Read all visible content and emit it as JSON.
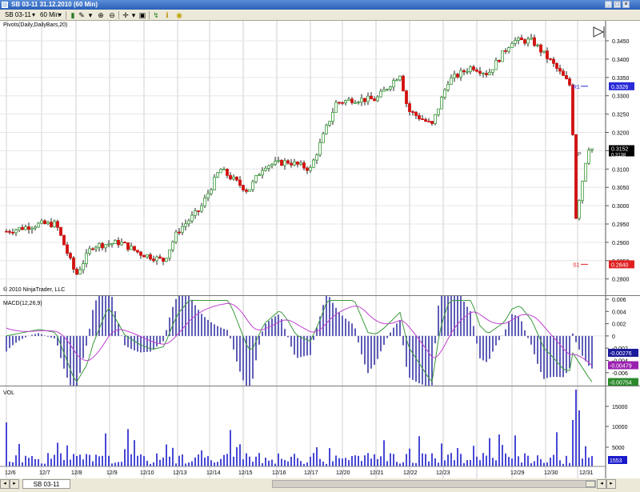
{
  "window": {
    "title": "SB 03-11   31.12.2010 (60 Min)"
  },
  "toolbar": {
    "instrument": "SB 03-11",
    "interval": "60 Min"
  },
  "price_pane": {
    "indicator_label": "Pivots(Daily,DailyBars,20)",
    "copyright": "© 2010 NinjaTrader, LLC",
    "ticks": [
      "0.3450",
      "0.3400",
      "0.3350",
      "0.3300",
      "0.3250",
      "0.3200",
      "0.3150",
      "0.3100",
      "0.3050",
      "0.3000",
      "0.2950",
      "0.2900",
      "0.2850",
      "0.2800"
    ],
    "last_price": "0.3152",
    "last_price_sub": "0.3138",
    "r1_label": "R1",
    "r1_value": "0.3326",
    "p_label": "P",
    "s1_label": "S1",
    "s1_value": "0.2840",
    "colors": {
      "up": "#3a9a3a",
      "down": "#d21010",
      "r1": "#2a2ad8",
      "s1": "#e02020"
    }
  },
  "macd_pane": {
    "label": "MACD(12,26,9)",
    "ticks": [
      "0.006",
      "0.004",
      "0.002",
      "0",
      "-0.002",
      "-0.004",
      "-0.006"
    ],
    "macd_value": "-0.00276",
    "avg_value": "-0.00479",
    "diff_value": "-0.00754",
    "colors": {
      "macd": "#3a9a3a",
      "avg": "#c040d0",
      "hist": "#1a1a9a"
    }
  },
  "volume_pane": {
    "label": "VOL",
    "ticks": [
      "15000",
      "10000",
      "5000"
    ],
    "last_volume": "1553",
    "color": "#1a1acc"
  },
  "x_axis": {
    "labels": [
      "12/6",
      "12/7",
      "12/8",
      "12/9",
      "12/10",
      "12/13",
      "12/14",
      "12/15",
      "12/16",
      "12/17",
      "12/20",
      "12/21",
      "12/22",
      "12/23",
      "12/29",
      "12/30",
      "12/31"
    ]
  },
  "bottom_bar": {
    "tab_label": "SB 03-11"
  }
}
